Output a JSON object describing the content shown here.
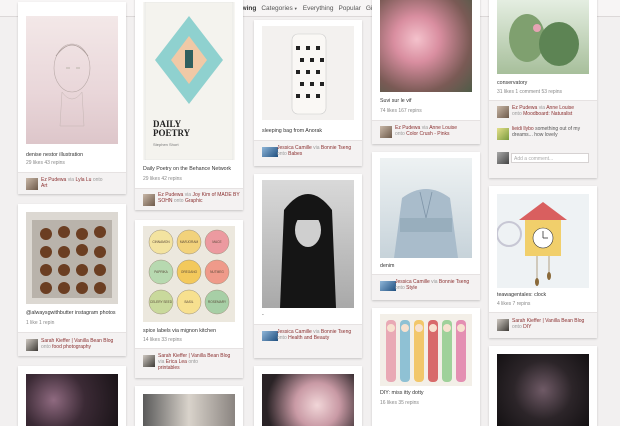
{
  "nav": {
    "following": "Following",
    "categories": "Categories",
    "everything": "Everything",
    "popular": "Popular",
    "gifts": "Gifts"
  },
  "pins": {
    "denise": {
      "desc": "denise nestor illustration",
      "stats": "29 likes   43 repins",
      "user": "Ez Pudewa",
      "via": "Lyla Lu",
      "board": "Art"
    },
    "cookies": {
      "desc": "@alwaysgwithbutter instagram photos",
      "stats": "1 like   1 repin",
      "user": "Sarah Kieffer | Vanilla Bean Blog",
      "board": "food photography"
    },
    "poetry": {
      "desc": "Daily Poetry on the Behance Network",
      "stats": "29 likes   42 repins",
      "user": "Ez Pudewa",
      "via": "Joy Kim of MADE BY SOHN",
      "board": "Graphic",
      "poster_title": "DAILY\nPOETRY",
      "poster_sub": "Stephen Short"
    },
    "spice": {
      "desc": "spice labels via mignon kitchen",
      "stats": "14 likes   33 repins",
      "user": "Sarah Kieffer | Vanilla Bean Blog",
      "via": "Erica Lea",
      "board": "printables",
      "labels": [
        "CINNAMON",
        "MARJORAM",
        "MACE",
        "PAPRIKA",
        "OREGANO",
        "NUTMEG",
        "CELERY SEED",
        "BASIL",
        "ROSEMARY"
      ]
    },
    "sleeping": {
      "desc": "sleeping bag from Anorak",
      "user": "Jessica Camille",
      "via": "Bonnie Tseng",
      "board": "Babes"
    },
    "portrait": {
      "desc": "-",
      "user": "Jessica Camille",
      "via": "Bonnie Tseng",
      "board": "Health and Beauty"
    },
    "roses": {
      "desc": "Suvi sur le vif",
      "stats": "74 likes   167 repins",
      "user": "Ez Pudewa",
      "via": "Anne Louise",
      "board": "Color Crush - Pinks"
    },
    "denim": {
      "desc": "denim",
      "user": "Jessica Camille",
      "via": "Bonnie Tseng",
      "board": "Style"
    },
    "dolls": {
      "desc": "DIY: miss itty dotty",
      "stats": "16 likes   35 repins"
    },
    "conservatory": {
      "desc": "conservatory",
      "stats": "31 likes   1 comment   53 repins",
      "user": "Ez Pudewa",
      "via": "Anne Louise",
      "board": "Moodboard: Naturalist",
      "comment_user": "lieidi llybo",
      "comment_text": "something out of my dreams... how lovely",
      "comment_placeholder": "Add a comment..."
    },
    "clock": {
      "desc": "teawagentales: clock",
      "stats": "4 likes   7 repins",
      "user": "Sarah Kieffer | Vanilla Bean Blog",
      "board": "DIY"
    }
  },
  "words": {
    "via": "via",
    "onto": "onto"
  },
  "colors": {
    "accent": "#8a2f2f",
    "background": "#f2f0f0",
    "card": "#ffffff"
  }
}
